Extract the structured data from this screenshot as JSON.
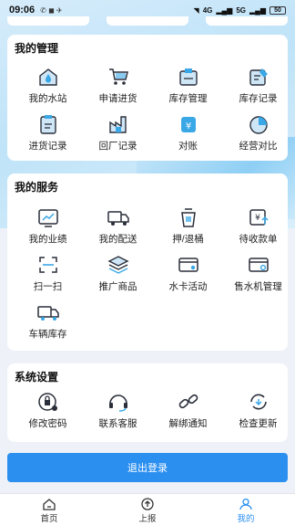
{
  "status_bar": {
    "time": "09:06",
    "network": "4G",
    "network2": "5G",
    "battery": "50"
  },
  "management": {
    "title": "我的管理",
    "items": [
      {
        "label": "我的水站",
        "icon": "water-station-icon"
      },
      {
        "label": "申请进货",
        "icon": "shopping-cart-icon"
      },
      {
        "label": "库存管理",
        "icon": "inventory-box-icon"
      },
      {
        "label": "库存记录",
        "icon": "inventory-record-icon"
      },
      {
        "label": "进货记录",
        "icon": "purchase-record-icon"
      },
      {
        "label": "回厂记录",
        "icon": "factory-return-icon"
      },
      {
        "label": "对账",
        "icon": "reconcile-icon"
      },
      {
        "label": "经营对比",
        "icon": "pie-chart-icon"
      }
    ]
  },
  "services": {
    "title": "我的服务",
    "items": [
      {
        "label": "我的业绩",
        "icon": "performance-chart-icon"
      },
      {
        "label": "我的配送",
        "icon": "delivery-truck-icon"
      },
      {
        "label": "押/退桶",
        "icon": "bucket-deposit-icon"
      },
      {
        "label": "待收款单",
        "icon": "pending-payment-icon"
      },
      {
        "label": "扫一扫",
        "icon": "scan-icon"
      },
      {
        "label": "推广商品",
        "icon": "promote-stack-icon"
      },
      {
        "label": "水卡活动",
        "icon": "water-card-icon"
      },
      {
        "label": "售水机管理",
        "icon": "vending-machine-icon"
      },
      {
        "label": "车辆库存",
        "icon": "vehicle-stock-icon"
      }
    ]
  },
  "settings": {
    "title": "系统设置",
    "items": [
      {
        "label": "修改密码",
        "icon": "lock-gear-icon"
      },
      {
        "label": "联系客服",
        "icon": "headset-icon"
      },
      {
        "label": "解绑通知",
        "icon": "unlink-icon"
      },
      {
        "label": "检查更新",
        "icon": "refresh-icon"
      }
    ]
  },
  "logout_label": "退出登录",
  "tabbar": {
    "home": "首页",
    "report": "上报",
    "mine": "我的"
  },
  "colors": {
    "accent": "#2b8ff0",
    "icon_dark": "#2a2f3a",
    "icon_teal": "#3aa7e6"
  }
}
